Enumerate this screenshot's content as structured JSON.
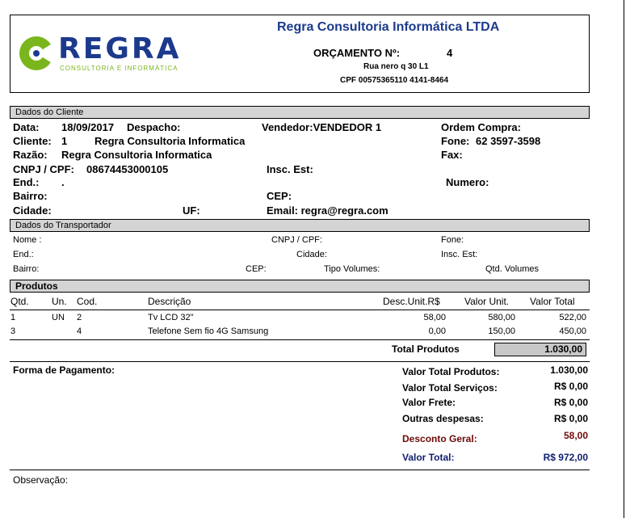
{
  "company": {
    "name": "Regra Consultoria Informática LTDA",
    "logo_text": "REGRA",
    "logo_sub": "CONSULTORIA E INFORMÁTICA",
    "orcamento_label": "ORÇAMENTO Nº:",
    "orcamento_num": "4",
    "address": "Rua nero q 30 L1",
    "doc": "CPF 00575365110 4141-8464"
  },
  "cliente_section": {
    "title": "Dados do Cliente",
    "data_label": "Data:",
    "data": "18/09/2017",
    "despacho_label": "Despacho:",
    "vendedor": "Vendedor:VENDEDOR 1",
    "ordem_label": "Ordem Compra:",
    "cliente_label": "Cliente:",
    "cliente_cod": "1",
    "cliente_nome": "Regra Consultoria Informatica",
    "fone_label": "Fone:",
    "fone": "62 3597-3598",
    "razao_label": "Razão:",
    "razao": "Regra Consultoria Informatica",
    "fax_label": "Fax:",
    "cnpj_label": "CNPJ / CPF:",
    "cnpj": "08674453000105",
    "insc_label": "Insc. Est:",
    "end_label": "End.:",
    "end": ".",
    "numero_label": "Numero:",
    "bairro_label": "Bairro:",
    "cep_label": "CEP:",
    "cidade_label": "Cidade:",
    "uf_label": "UF:",
    "email": "Email: regra@regra.com"
  },
  "transportador": {
    "title": "Dados do Transportador",
    "nome": "Nome :",
    "cnpj": "CNPJ / CPF:",
    "fone": "Fone:",
    "end": "End.:",
    "cidade": "Cidade:",
    "insc": "Insc. Est:",
    "bairro": "Bairro:",
    "cep": "CEP:",
    "tipo_volumes": "Tipo Volumes:",
    "qtd_volumes": "Qtd. Volumes"
  },
  "produtos": {
    "title": "Produtos",
    "headers": {
      "qtd": "Qtd.",
      "un": "Un.",
      "cod": "Cod.",
      "desc": "Descrição",
      "desc_unit": "Desc.Unit.R$",
      "valor_unit": "Valor Unit.",
      "valor_total": "Valor Total"
    },
    "rows": [
      {
        "qtd": "1",
        "un": "UN",
        "cod": "2",
        "desc": "Tv LCD 32\"",
        "desc_unit": "58,00",
        "valor_unit": "580,00",
        "valor_total": "522,00"
      },
      {
        "qtd": "3",
        "un": "",
        "cod": "4",
        "desc": "Telefone Sem fio 4G Samsung",
        "desc_unit": "0,00",
        "valor_unit": "150,00",
        "valor_total": "450,00"
      }
    ],
    "total_label": "Total  Produtos",
    "total_value": "1.030,00"
  },
  "pagamento": {
    "forma_label": "Forma de Pagamento:",
    "vt_produtos_label": "Valor Total Produtos:",
    "vt_produtos": "1.030,00",
    "vt_servicos_label": "Valor Total Serviços:",
    "vt_servicos": "R$ 0,00",
    "frete_label": "Valor Frete:",
    "frete": "R$ 0,00",
    "outras_label": "Outras despesas:",
    "outras": "R$ 0,00",
    "desconto_label": "Desconto Geral:",
    "desconto": "58,00",
    "total_label": "Valor Total:",
    "total": "R$ 972,00"
  },
  "observacao_label": "Observação:",
  "colors": {
    "brand_blue": "#1c3a8c",
    "brand_green": "#7ab51d",
    "discount": "#6e0a0a",
    "total_blue": "#0f1f6e"
  }
}
